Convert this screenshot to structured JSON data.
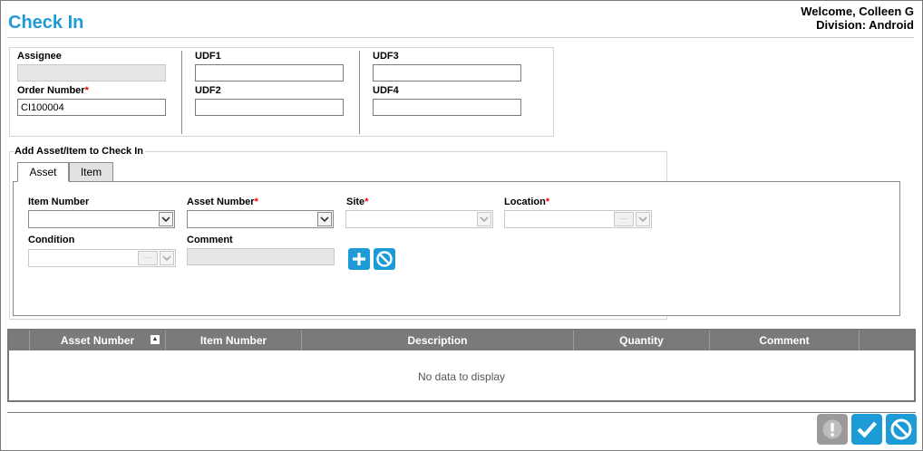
{
  "page": {
    "title": "Check In",
    "welcome": "Welcome, Colleen G",
    "division": "Division: Android"
  },
  "header_form": {
    "assignee_label": "Assignee",
    "assignee_value": "",
    "order_number_label": "Order Number",
    "order_number_value": "CI100004",
    "udf1_label": "UDF1",
    "udf2_label": "UDF2",
    "udf3_label": "UDF3",
    "udf4_label": "UDF4",
    "required_mark": "*"
  },
  "add_section": {
    "legend": "Add Asset/Item to Check In",
    "tabs": [
      {
        "label": "Asset",
        "active": true
      },
      {
        "label": "Item",
        "active": false
      }
    ],
    "item_number_label": "Item Number",
    "asset_number_label": "Asset Number",
    "site_label": "Site",
    "location_label": "Location",
    "condition_label": "Condition",
    "comment_label": "Comment",
    "ellipsis": "···"
  },
  "grid": {
    "columns": [
      "Asset Number",
      "Item Number",
      "Description",
      "Quantity",
      "Comment"
    ],
    "sort_indicator": "▲",
    "empty_text": "No data to display"
  },
  "colors": {
    "accent": "#1d9bd7",
    "disabled_button": "#9a9a9a",
    "header_gray": "#7a7a7a"
  },
  "icons": [
    "plus-icon",
    "cancel-icon",
    "exclamation-icon",
    "checkmark-icon",
    "chevron-down-icon",
    "sort-up-icon"
  ]
}
